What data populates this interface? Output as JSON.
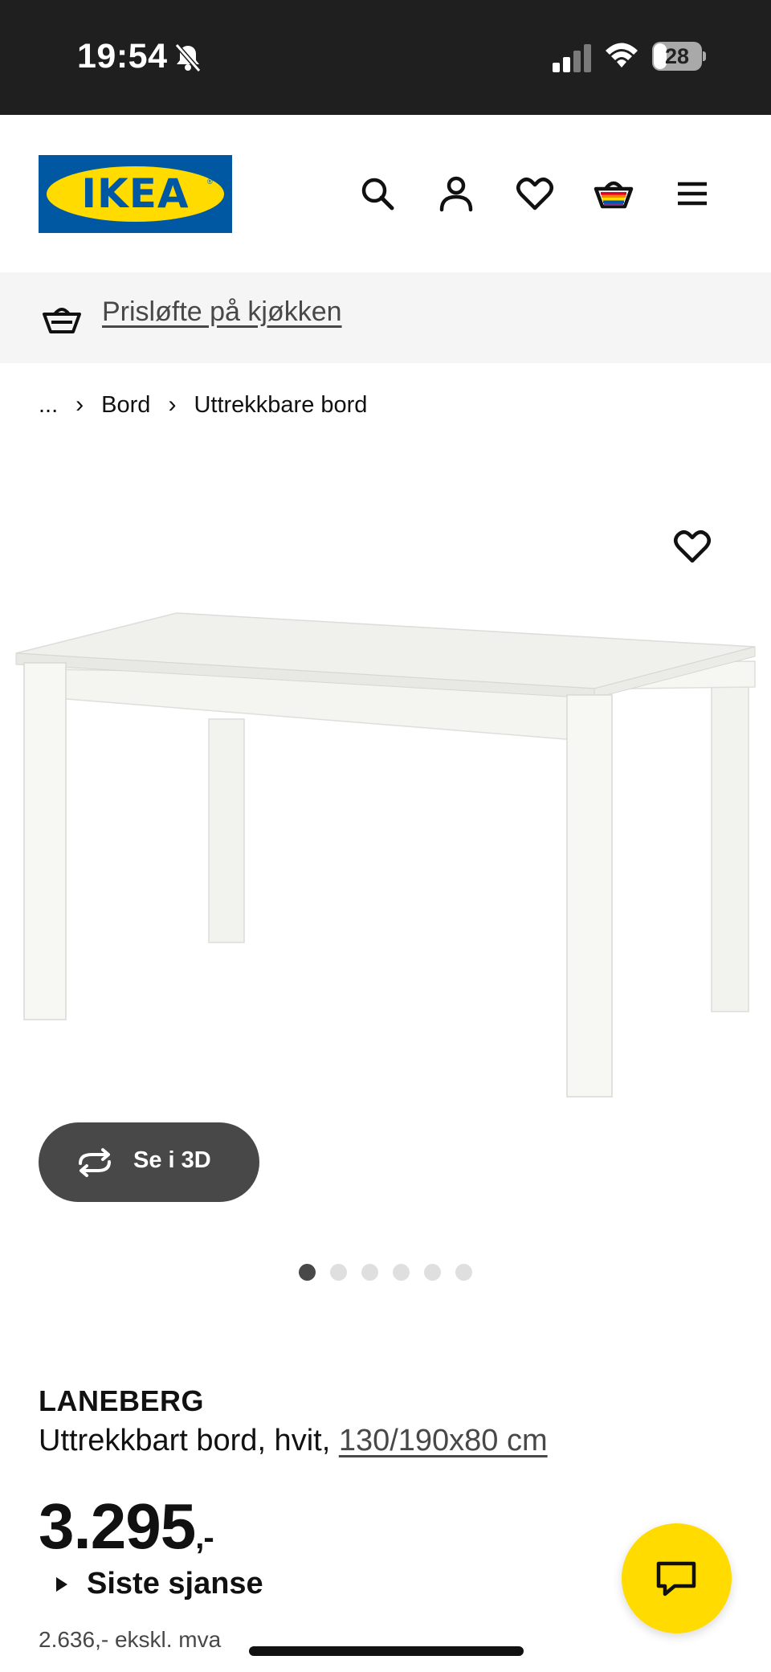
{
  "status_bar": {
    "time": "19:54",
    "battery_level": "28",
    "icons": [
      "bell-slash-icon",
      "signal-icon",
      "wifi-icon",
      "battery-icon"
    ]
  },
  "header": {
    "logo_text": "IKEA",
    "logo_colors": {
      "blue": "#0058a3",
      "yellow": "#ffdb00"
    },
    "icons": [
      "search-icon",
      "account-icon",
      "heart-icon",
      "basket-icon",
      "menu-icon"
    ]
  },
  "promo": {
    "link_text": "Prisløfte på kjøkken",
    "icon": "basket-icon"
  },
  "breadcrumb": {
    "ellipsis": "...",
    "items": [
      "Bord",
      "Uttrekkbare bord"
    ]
  },
  "gallery": {
    "view_3d_label": "Se i 3D",
    "slide_count": 6,
    "active_slide": 1
  },
  "product": {
    "name": "LANEBERG",
    "description": "Uttrekkbart bord, hvit, ",
    "size_link": "130/190x80 cm",
    "price_main": "3.295",
    "price_suffix": ",-",
    "last_chance": "Siste sjanse",
    "price_ex_vat": "2.636,- ekskl. mva"
  },
  "chat": {
    "icon": "chat-icon",
    "color": "#ffdb00"
  }
}
